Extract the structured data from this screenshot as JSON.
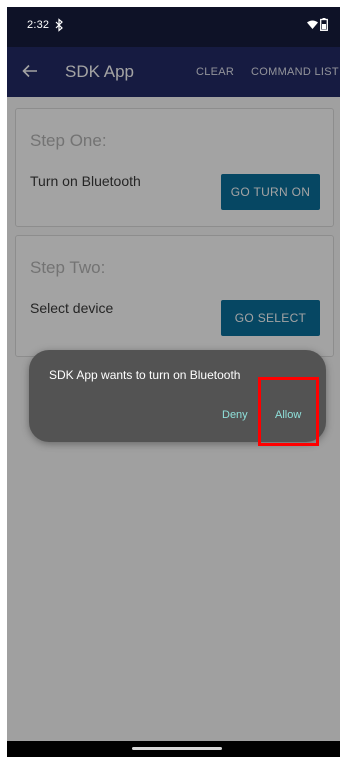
{
  "status_bar": {
    "time": "2:32",
    "icons": [
      "bluetooth-icon",
      "wifi-icon",
      "battery-icon"
    ]
  },
  "app_bar": {
    "title": "SDK App",
    "actions": [
      "CLEAR",
      "COMMAND LIST"
    ],
    "back_icon": "back-arrow-icon",
    "color": "#232b66"
  },
  "cards": [
    {
      "title": "Step One:",
      "description": "Turn on Bluetooth",
      "button_label": "GO TURN ON"
    },
    {
      "title": "Step Two:",
      "description": "Select device",
      "button_label": "GO SELECT"
    }
  ],
  "dialog": {
    "message": "SDK App wants to turn on Bluetooth",
    "deny_label": "Deny",
    "allow_label": "Allow",
    "accent_color": "#8fe0da"
  },
  "highlight": {
    "target": "allow-button",
    "color": "#ff0000"
  }
}
